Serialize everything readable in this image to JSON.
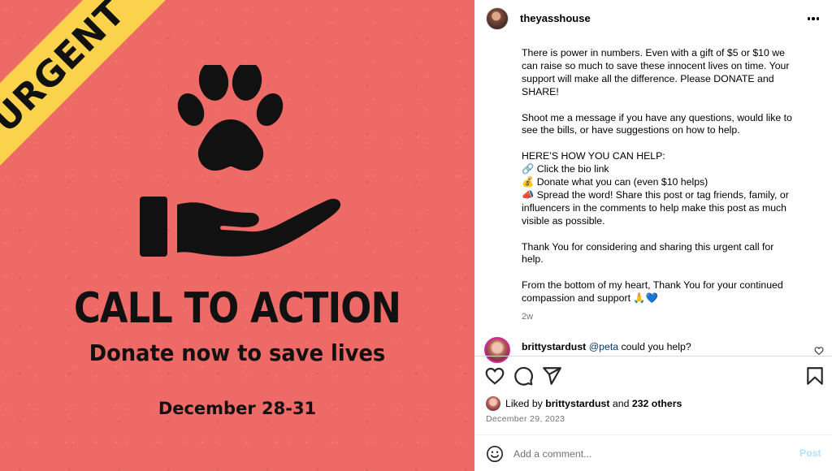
{
  "media": {
    "banner": "URGENT",
    "title": "CALL TO ACTION",
    "subtitle": "Donate now to save lives",
    "date": "December 28-31",
    "background_color": "#ee6a67",
    "banner_color": "#fad24b",
    "icon": "paw-on-hand-icon"
  },
  "post": {
    "username": "theyasshouse",
    "more_icon": "more-options-icon"
  },
  "caption": {
    "lines": [
      "There is power in numbers. Even with a gift of $5 or $10 we",
      "can raise so much to save these innocent lives on time. Your",
      "support will make all the difference. Please DONATE and",
      "SHARE!",
      "",
      "Shoot me a message if you have any questions, would like to",
      "see the bills, or have suggestions on how to help.",
      "",
      "HERE’S HOW YOU CAN HELP:",
      "🔗 Click the bio link",
      "💰 Donate what you can (even $10 helps)",
      "📣 Spread the word! Share this post or tag friends, family, or",
      "influencers in the comments to help make this post as much",
      "visible as possible.",
      "",
      "Thank You for considering and sharing this urgent call for",
      "help.",
      "",
      "From the bottom of my heart, Thank You for your continued",
      "compassion and support 🙏💙"
    ],
    "time_ago": "2w"
  },
  "comment": {
    "username": "brittystardust",
    "mention": "@peta",
    "text": " could you help?"
  },
  "actions": {
    "like_icon": "heart-icon",
    "comment_icon": "comment-icon",
    "share_icon": "share-icon",
    "save_icon": "bookmark-icon"
  },
  "likes": {
    "prefix": "Liked by ",
    "user": "brittystardust",
    "middle": " and ",
    "others": "232 others"
  },
  "post_date": "December 29, 2023",
  "add_comment": {
    "placeholder": "Add a comment...",
    "post_label": "Post",
    "emoji_icon": "emoji-icon"
  }
}
